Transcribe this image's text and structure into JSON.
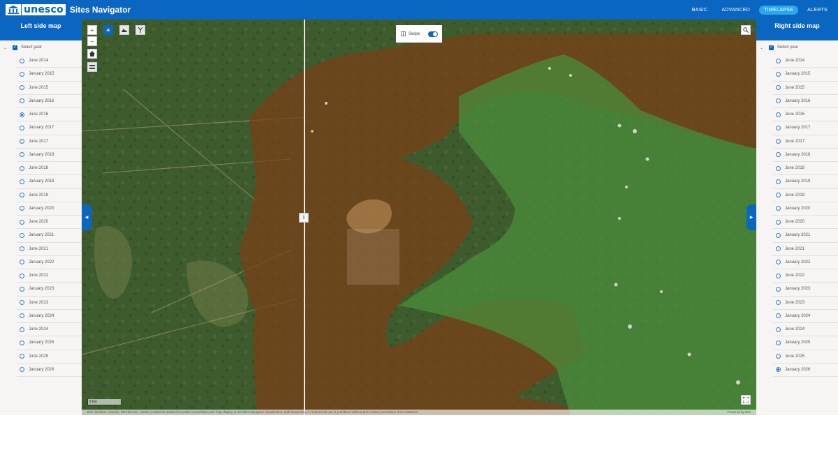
{
  "header": {
    "logo_text": "unesco",
    "app_title": "Sites Navigator",
    "nav": [
      {
        "label": "BASIC",
        "active": false
      },
      {
        "label": "ADVANCED",
        "active": false
      },
      {
        "label": "TIMELAPSE",
        "active": true
      },
      {
        "label": "ALERTS",
        "active": false
      }
    ]
  },
  "left_panel": {
    "title": "Left side map",
    "select_label": "Select year",
    "selected": "June 2016"
  },
  "right_panel": {
    "title": "Right side map",
    "select_label": "Select year",
    "selected": "January 2026"
  },
  "years": [
    "June 2014",
    "January 2015",
    "June 2015",
    "January 2016",
    "June 2016",
    "January 2017",
    "June 2017",
    "January 2018",
    "June 2018",
    "January 2019",
    "June 2019",
    "January 2020",
    "June 2020",
    "January 2021",
    "June 2021",
    "January 2022",
    "June 2022",
    "January 2023",
    "June 2023",
    "January 2024",
    "June 2024",
    "January 2025",
    "June 2025",
    "January 2026"
  ],
  "map": {
    "swipe_label": "Swipe",
    "swipe_enabled": true,
    "scale_label": "5 km",
    "attribution": "Esri, TomTom, Garmin, METI/NASA, USGS | UNESCO dataset for public consultation and map display on its Sites Navigator visualization, bulk harvesting or commercial use is prohibited without prior written permission from UNESCO",
    "powered_by": "Powered by Esri",
    "icons": {
      "zoom_in": "plus-icon",
      "zoom_out": "minus-icon",
      "home": "home-icon",
      "layers": "layers-icon",
      "sun": "sun-icon",
      "landscape": "landscape-icon",
      "filter": "filter-icon",
      "search": "search-icon",
      "fullscreen": "fullscreen-icon"
    },
    "colors": {
      "forest": "#3d5a2c",
      "core_overlay": "#4b8a3c",
      "buffer_overlay": "#8a4a1c",
      "accent": "#0b66c2"
    }
  }
}
